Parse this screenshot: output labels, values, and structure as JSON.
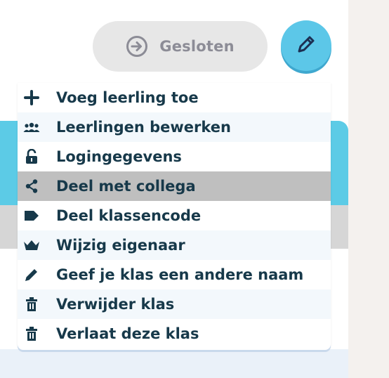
{
  "header": {
    "status_label": "Gesloten"
  },
  "menu": {
    "items": [
      {
        "label": "Voeg leerling toe",
        "icon": "plus-icon"
      },
      {
        "label": "Leerlingen bewerken",
        "icon": "users-icon"
      },
      {
        "label": "Logingegevens",
        "icon": "unlock-icon"
      },
      {
        "label": "Deel met collega",
        "icon": "share-icon",
        "active": true
      },
      {
        "label": "Deel klassencode",
        "icon": "tag-icon"
      },
      {
        "label": "Wijzig eigenaar",
        "icon": "crown-icon"
      },
      {
        "label": "Geef je klas een andere naam",
        "icon": "pencil-icon"
      },
      {
        "label": "Verwijder klas",
        "icon": "trash-icon"
      },
      {
        "label": "Verlaat deze klas",
        "icon": "trash-icon"
      }
    ]
  },
  "colors": {
    "accent": "#5cc7e8",
    "text": "#17394a",
    "active_row": "#bfbfbf"
  }
}
